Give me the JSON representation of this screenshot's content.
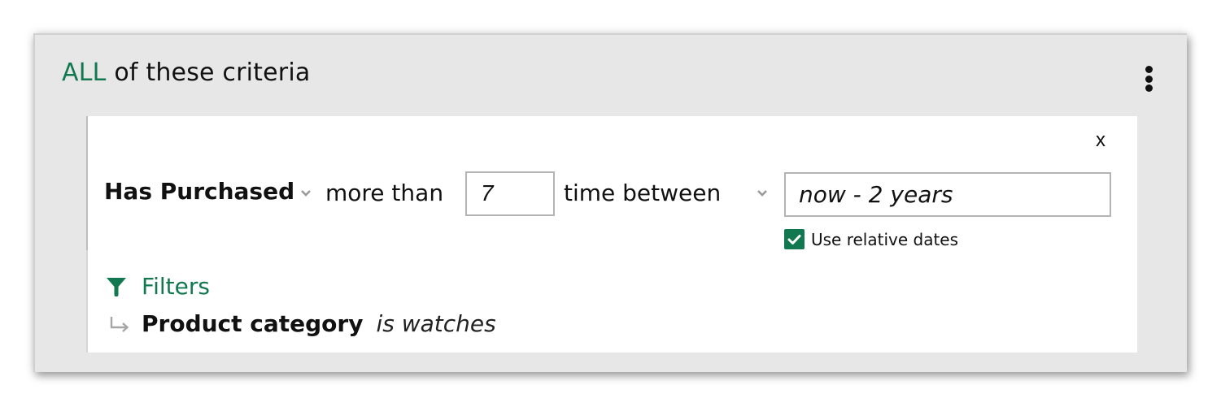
{
  "header": {
    "quantifier": "ALL",
    "title_rest": "of these criteria",
    "menu_icon": "more-vertical-icon"
  },
  "condition": {
    "close_label": "x",
    "event": "Has Purchased",
    "comparator": "more than",
    "count_value": "7",
    "time_mode": "time between",
    "date_value": "now - 2 years",
    "relative_dates": {
      "label": "Use relative dates",
      "checked": true
    },
    "filters": {
      "label": "Filters",
      "icon": "filter-icon",
      "items": [
        {
          "field": "Product category",
          "operator_value": "is watches"
        }
      ]
    }
  },
  "colors": {
    "accent": "#12784f",
    "panel_bg": "#e7e7e7",
    "card_bg": "#ffffff",
    "input_border": "#b4b4b4"
  }
}
